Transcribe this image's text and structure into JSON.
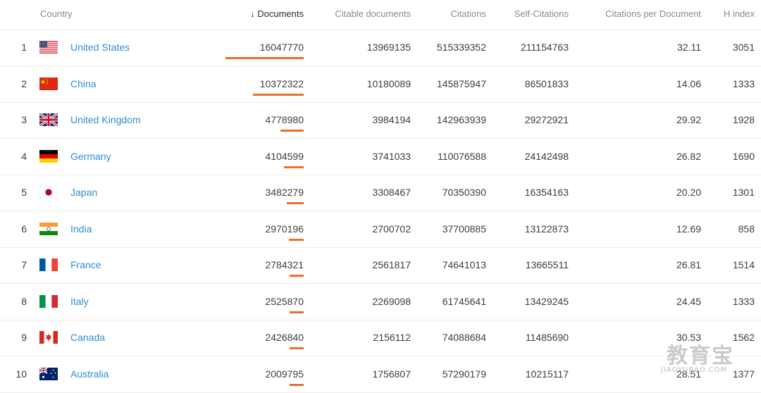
{
  "table": {
    "headers": {
      "country": "Country",
      "sort_arrow": "↓",
      "documents": "Documents",
      "citable": "Citable documents",
      "citations": "Citations",
      "self_citations": "Self-Citations",
      "cpd": "Citations per Document",
      "h_index": "H index"
    },
    "rows": [
      {
        "rank": "1",
        "country": "United States",
        "flag": "us-flag-icon",
        "documents": "16047770",
        "citable": "13969135",
        "citations": "515339352",
        "self": "211154763",
        "cpd": "32.11",
        "h": "3051",
        "doc_value": 16047770
      },
      {
        "rank": "2",
        "country": "China",
        "flag": "cn-flag-icon",
        "documents": "10372322",
        "citable": "10180089",
        "citations": "145875947",
        "self": "86501833",
        "cpd": "14.06",
        "h": "1333",
        "doc_value": 10372322
      },
      {
        "rank": "3",
        "country": "United Kingdom",
        "flag": "gb-flag-icon",
        "documents": "4778980",
        "citable": "3984194",
        "citations": "142963939",
        "self": "29272921",
        "cpd": "29.92",
        "h": "1928",
        "doc_value": 4778980
      },
      {
        "rank": "4",
        "country": "Germany",
        "flag": "de-flag-icon",
        "documents": "4104599",
        "citable": "3741033",
        "citations": "110076588",
        "self": "24142498",
        "cpd": "26.82",
        "h": "1690",
        "doc_value": 4104599
      },
      {
        "rank": "5",
        "country": "Japan",
        "flag": "jp-flag-icon",
        "documents": "3482279",
        "citable": "3308467",
        "citations": "70350390",
        "self": "16354163",
        "cpd": "20.20",
        "h": "1301",
        "doc_value": 3482279
      },
      {
        "rank": "6",
        "country": "India",
        "flag": "in-flag-icon",
        "documents": "2970196",
        "citable": "2700702",
        "citations": "37700885",
        "self": "13122873",
        "cpd": "12.69",
        "h": "858",
        "doc_value": 2970196
      },
      {
        "rank": "7",
        "country": "France",
        "flag": "fr-flag-icon",
        "documents": "2784321",
        "citable": "2561817",
        "citations": "74641013",
        "self": "13665511",
        "cpd": "26.81",
        "h": "1514",
        "doc_value": 2784321
      },
      {
        "rank": "8",
        "country": "Italy",
        "flag": "it-flag-icon",
        "documents": "2525870",
        "citable": "2269098",
        "citations": "61745641",
        "self": "13429245",
        "cpd": "24.45",
        "h": "1333",
        "doc_value": 2525870
      },
      {
        "rank": "9",
        "country": "Canada",
        "flag": "ca-flag-icon",
        "documents": "2426840",
        "citable": "2156112",
        "citations": "74088684",
        "self": "11485690",
        "cpd": "30.53",
        "h": "1562",
        "doc_value": 2426840
      },
      {
        "rank": "10",
        "country": "Australia",
        "flag": "au-flag-icon",
        "documents": "2009795",
        "citable": "1756807",
        "citations": "57290179",
        "self": "10215117",
        "cpd": "28.51",
        "h": "1377",
        "doc_value": 2009795
      }
    ]
  },
  "colors": {
    "link": "#2f8fcf",
    "bar": "#ef6b2b",
    "header_text": "#8a8a8a"
  },
  "watermark": {
    "main": "教育宝",
    "sub": "JIAOYUBAO.COM"
  }
}
